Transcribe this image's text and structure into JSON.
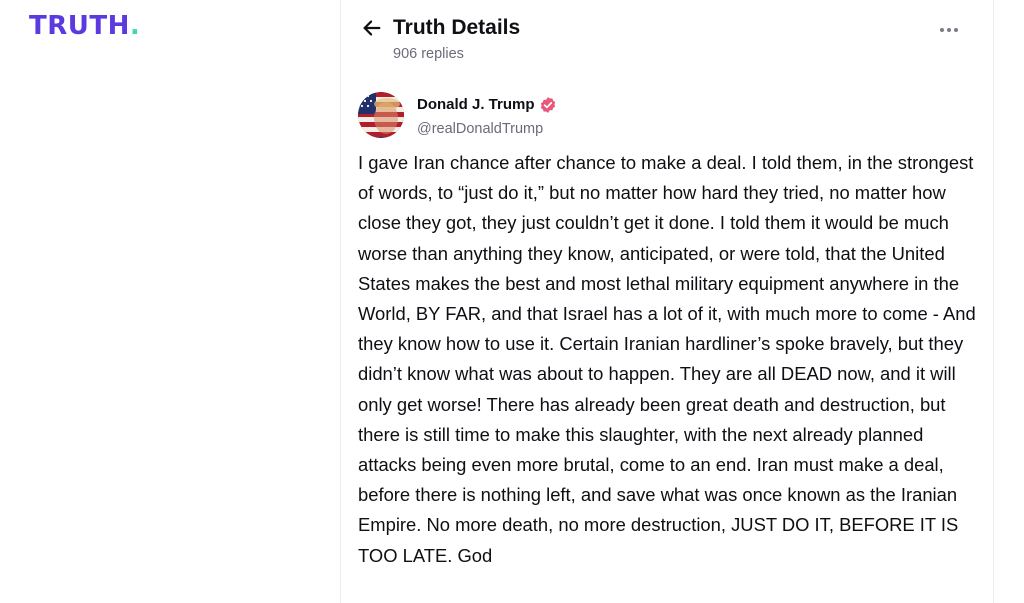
{
  "brand": {
    "logo_text": "TRUTH",
    "logo_dot": ".",
    "colors": {
      "logo": "#5b3be0",
      "logo_dot": "#3fd7b5",
      "verified_badge": "#e8587a",
      "secondary_text": "#6b6b78"
    }
  },
  "header": {
    "back_icon": "arrow-left-icon",
    "title": "Truth Details",
    "replies": "906 replies",
    "more_icon": "more-horizontal-icon"
  },
  "post": {
    "author": {
      "name": "Donald J. Trump",
      "handle": "@realDonaldTrump",
      "verified_icon": "verified-badge-icon",
      "avatar_icon": "avatar-image"
    },
    "text": "I gave Iran chance after chance to make a deal. I told them, in the strongest of words, to “just do it,” but no matter how hard they tried, no matter how close they got, they just couldn’t get it done. I told them it would be much worse than anything they know, anticipated, or were told, that the United States makes the best and most lethal military equipment anywhere in the World, BY FAR, and that Israel has a lot of it, with much more to come - And they know how to use it. Certain Iranian hardliner’s spoke bravely, but they didn’t know what was about to happen. They are all DEAD now, and it will only get worse! There has already been great death and destruction, but there is still time to make this slaughter, with the next already planned attacks being even more brutal, come to an end. Iran must make a deal, before there is nothing left, and save what was once known as the Iranian Empire. No more death, no more destruction, JUST DO IT, BEFORE IT IS TOO LATE. God"
  }
}
